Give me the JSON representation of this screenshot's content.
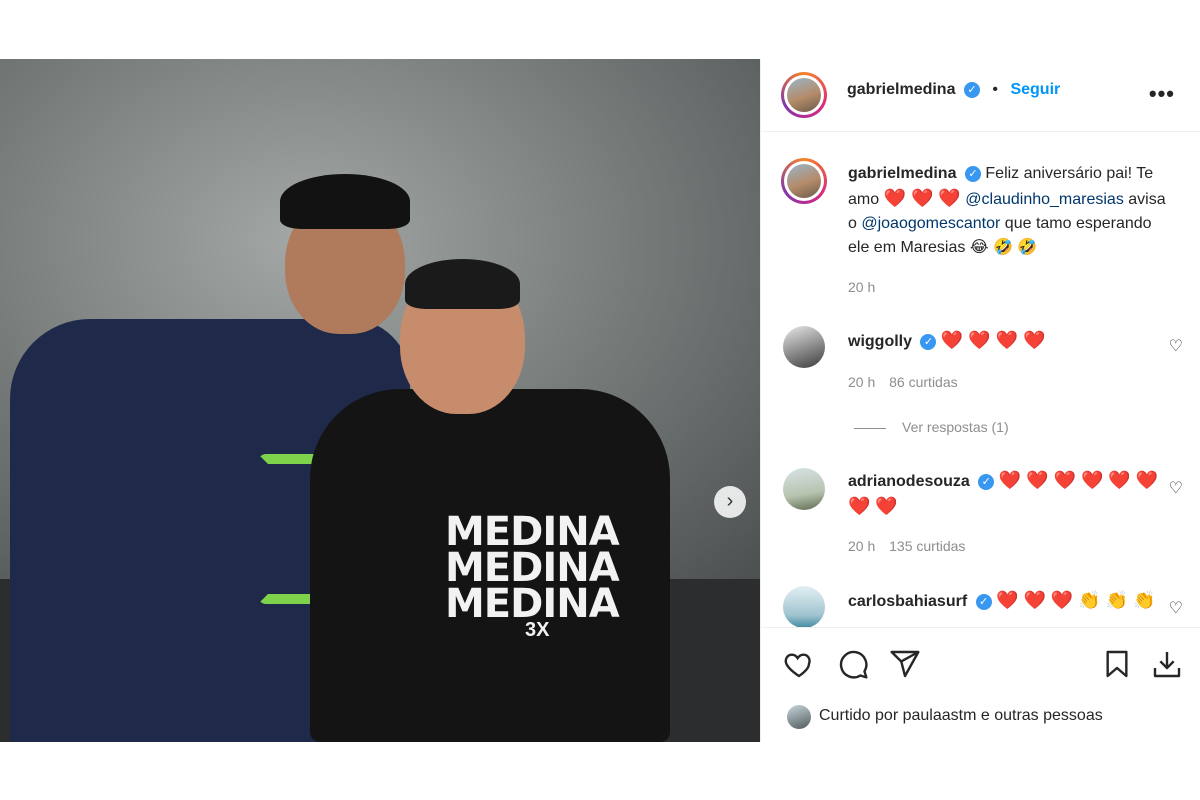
{
  "post": {
    "photo": {
      "shirt_text": "MEDINA\nMEDINA\nMEDINA",
      "shirt_sub": "3X",
      "carousel_next_icon": "chevron-right-icon"
    },
    "header": {
      "username": "gabrielmedina",
      "verified_icon": "verified-badge-icon",
      "separator": "•",
      "follow_label": "Seguir",
      "more_icon": "more-options-icon",
      "more_label": "•••"
    },
    "caption": {
      "username": "gabrielmedina",
      "text_1": "Feliz aniversário pai! Te amo",
      "hearts": "❤️ ❤️ ❤️",
      "mention_1": "@claudinho_maresias",
      "text_2": "avisa o",
      "mention_2": "@joaogomescantor",
      "text_3": "que tamo esperando ele em Maresias",
      "emojis": "😂 🤣 🤣",
      "time": "20 h"
    },
    "comments": [
      {
        "username": "wiggolly",
        "text": "❤️ ❤️ ❤️ ❤️",
        "time": "20 h",
        "likes": "86 curtidas",
        "view_replies": "Ver respostas (1)"
      },
      {
        "username": "adrianodesouza",
        "text": "❤️ ❤️ ❤️ ❤️ ❤️ ❤️ ❤️ ❤️",
        "time": "20 h",
        "likes": "135 curtidas"
      },
      {
        "username": "carlosbahiasurf",
        "text": "❤️ ❤️ ❤️ 👏 👏 👏"
      }
    ],
    "actions": {
      "like_icon": "heart-icon",
      "comment_icon": "comment-icon",
      "share_icon": "share-icon",
      "save_icon": "bookmark-icon",
      "download_icon": "download-icon"
    },
    "liked_by": "Curtido por paulaastm e outras pessoas"
  }
}
